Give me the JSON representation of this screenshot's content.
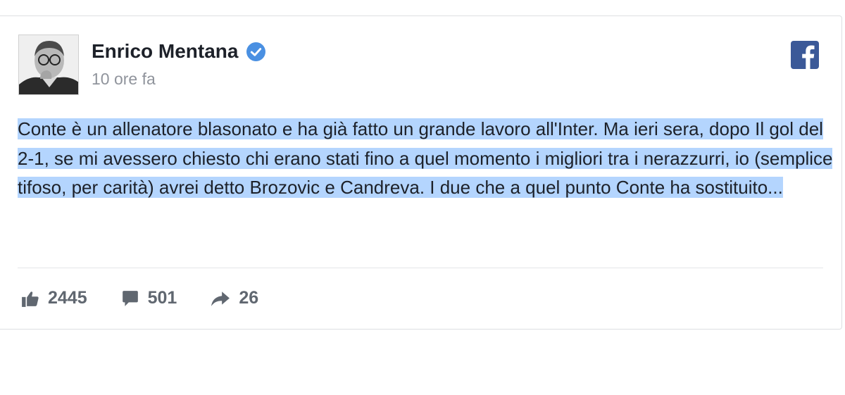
{
  "post": {
    "author": "Enrico Mentana",
    "verified": true,
    "timestamp": "10 ore fa",
    "text": "Conte è un allenatore blasonato e ha già fatto un grande lavoro all'Inter. Ma ieri sera, dopo Il gol del 2-1, se mi avessero chiesto chi erano stati fino a quel momento i migliori tra i nerazzurri, io (semplice tifoso, per carità) avrei detto Brozovic e Candreva. I due che a quel punto Conte ha sostituito...",
    "platform_icon": "facebook-icon"
  },
  "stats": {
    "likes": "2445",
    "comments": "501",
    "shares": "26"
  },
  "colors": {
    "facebook_blue": "#3b5998",
    "verified_blue": "#4a90e2",
    "selection_highlight": "#b4d5fe",
    "muted_text": "#90949c"
  }
}
